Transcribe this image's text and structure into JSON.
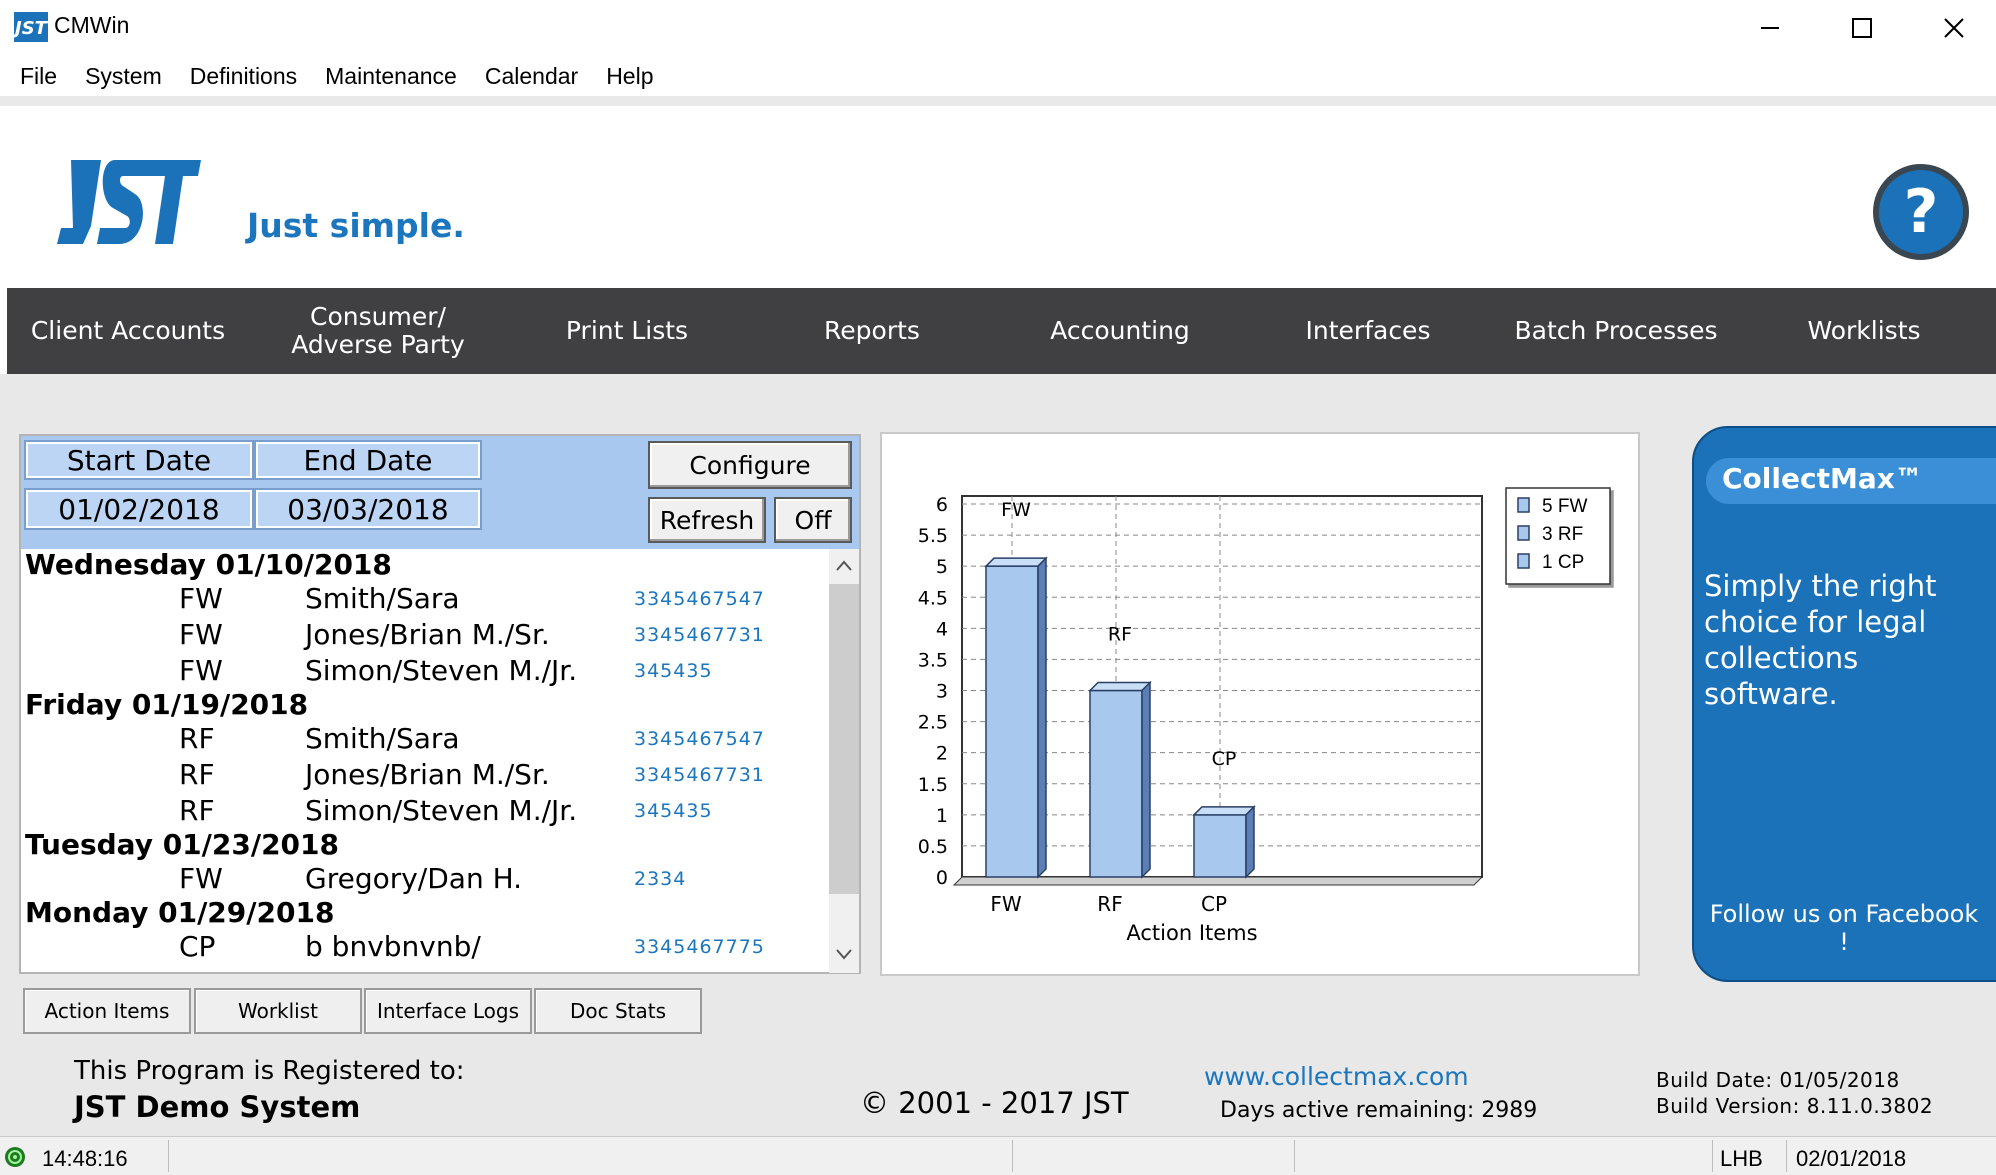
{
  "window": {
    "title": "CMWin"
  },
  "menu": [
    "File",
    "System",
    "Definitions",
    "Maintenance",
    "Calendar",
    "Help"
  ],
  "header": {
    "tagline": "Just simple.",
    "help_label": "?"
  },
  "nav": [
    "Client Accounts",
    "Consumer/\nAdverse Party",
    "Print Lists",
    "Reports",
    "Accounting",
    "Interfaces",
    "Batch Processes",
    "Worklists"
  ],
  "calendar": {
    "start_label": "Start Date",
    "end_label": "End Date",
    "start_value": "01/02/2018",
    "end_value": "03/03/2018",
    "configure_label": "Configure",
    "refresh_label": "Refresh",
    "off_label": "Off",
    "days": [
      {
        "day": "Wednesday 01/10/2018",
        "entries": [
          {
            "code": "FW",
            "name": "Smith/Sara",
            "number": "3345467547"
          },
          {
            "code": "FW",
            "name": "Jones/Brian M./Sr.",
            "number": "3345467731"
          },
          {
            "code": "FW",
            "name": "Simon/Steven M./Jr.",
            "number": "345435"
          }
        ]
      },
      {
        "day": "Friday 01/19/2018",
        "entries": [
          {
            "code": "RF",
            "name": "Smith/Sara",
            "number": "3345467547"
          },
          {
            "code": "RF",
            "name": "Jones/Brian M./Sr.",
            "number": "3345467731"
          },
          {
            "code": "RF",
            "name": "Simon/Steven M./Jr.",
            "number": "345435"
          }
        ]
      },
      {
        "day": "Tuesday 01/23/2018",
        "entries": [
          {
            "code": "FW",
            "name": "Gregory/Dan H.",
            "number": "2334"
          }
        ]
      },
      {
        "day": "Monday 01/29/2018",
        "entries": [
          {
            "code": "CP",
            "name": "b bnvbnvnb/",
            "number": "3345467775"
          }
        ]
      }
    ]
  },
  "tabs": [
    "Action Items",
    "Worklist",
    "Interface Logs",
    "Doc Stats"
  ],
  "chart_data": {
    "type": "bar",
    "categories": [
      "FW",
      "RF",
      "CP"
    ],
    "values": [
      5,
      3,
      1
    ],
    "bar_labels": [
      "FW",
      "RF",
      "CP"
    ],
    "xlabel": "Action Items",
    "ylabel": "",
    "ylim": [
      0,
      6
    ],
    "yticks": [
      "0",
      "0.5",
      "1",
      "1.5",
      "2",
      "2.5",
      "3",
      "3.5",
      "4",
      "4.5",
      "5",
      "5.5",
      "6"
    ],
    "legend": [
      "5 FW",
      "3 RF",
      "1 CP"
    ],
    "legend_position": "top-right",
    "grid": true,
    "bar_color": "#a8c8ee"
  },
  "promo": {
    "title": "CollectMax™",
    "text": "Simply the right choice for legal collections software.",
    "follow": "Follow us on Facebook !"
  },
  "footer": {
    "registered_label": "This Program is Registered to:",
    "registered_name": "JST Demo System",
    "copyright": "© 2001 - 2017 JST",
    "website": "www.collectmax.com",
    "days_active": "Days active remaining: 2989",
    "build_date": "Build Date: 01/05/2018",
    "build_version": "Build Version: 8.11.0.3802"
  },
  "status": {
    "time": "14:48:16",
    "user": "LHB",
    "date": "02/01/2018"
  },
  "colors": {
    "accent": "#1b76bd",
    "nav_bg": "#404042"
  }
}
